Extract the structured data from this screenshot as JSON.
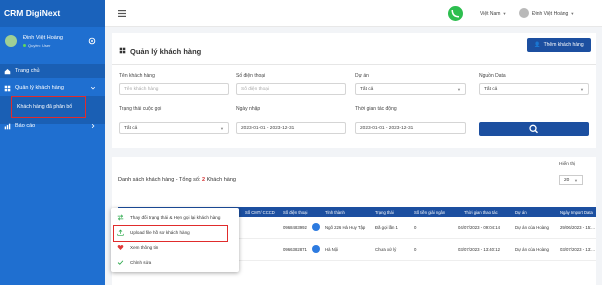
{
  "app": {
    "brand": "CRM DigiNext"
  },
  "user": {
    "name": "Đinh Việt Hoàng",
    "role": "Quyền: User"
  },
  "sidebar": {
    "items": [
      {
        "label": "Trang chủ"
      },
      {
        "label": "Quản lý khách hàng"
      },
      {
        "label": "Khách hàng đã phân bổ"
      },
      {
        "label": "Báo cáo"
      }
    ]
  },
  "topbar": {
    "language": "Việt Nam",
    "user": "Đinh Việt Hoàng"
  },
  "page": {
    "title": "Quản lý khách hàng",
    "add_button": "Thêm khách hàng"
  },
  "filters": {
    "customer_name": {
      "label": "Tên khách hàng",
      "placeholder": "Tên khách hàng"
    },
    "phone": {
      "label": "Số điện thoại",
      "placeholder": "Số điện thoại"
    },
    "project": {
      "label": "Dự án",
      "value": "Tất cả"
    },
    "source": {
      "label": "Nguồn Data",
      "value": "Tất cả"
    },
    "call_status": {
      "label": "Trạng thái cuộc gọi",
      "value": "Tất cả"
    },
    "import_date": {
      "label": "Ngày nhập",
      "value": "2023-01-01 - 2023-12-31"
    },
    "action_time": {
      "label": "Thời gian tác động",
      "value": "2023-01-01 - 2023-12-31"
    }
  },
  "list": {
    "title_prefix": "Danh sách khách hàng - Tổng số:",
    "total": "2",
    "title_suffix": "Khách hàng",
    "show_label": "Hiển thị",
    "page_size": "20"
  },
  "table": {
    "headers": [
      "Số CMT/ CCCD",
      "Số điện thoại",
      "Tỉnh thành",
      "Trạng thái",
      "Số tiền giải ngân",
      "Thời gian thao tác",
      "Dự án",
      "Ngày Import Data"
    ],
    "rows": [
      {
        "phone": "0968483992",
        "province": "Ngõ 226 Hà Huy Tập",
        "status": "Đã gọi lần 1",
        "amount": "0",
        "time": "04/07/2023 - 09:04:14",
        "project": "Dự án của Hoàng",
        "import": "29/06/2023 - 15:..."
      },
      {
        "phone": "0966382871",
        "province": "Hà Nội",
        "status": "Chưa xử lý",
        "amount": "0",
        "time": "03/07/2023 - 13:40:12",
        "project": "Dự án của Hoàng",
        "import": "03/07/2023 - 13:..."
      }
    ]
  },
  "menu": {
    "items": [
      {
        "label": "Thay đổi trạng thái & Hẹn gọi lại khách hàng"
      },
      {
        "label": "Upload file hồ sơ khách hàng"
      },
      {
        "label": "Xem thông tin"
      },
      {
        "label": "Chỉnh sửa"
      }
    ]
  },
  "colors": {
    "sidebar": "#1f6fd0",
    "primary": "#1c4fa0",
    "highlight": "#e02c2c",
    "phone": "#2dbe4f"
  },
  "icons": [
    "hamburger-icon",
    "phone-icon",
    "gear-icon",
    "home-icon",
    "grid-icon",
    "chart-icon",
    "search-icon",
    "swap-icon",
    "upload-icon",
    "heart-icon",
    "check-icon"
  ]
}
